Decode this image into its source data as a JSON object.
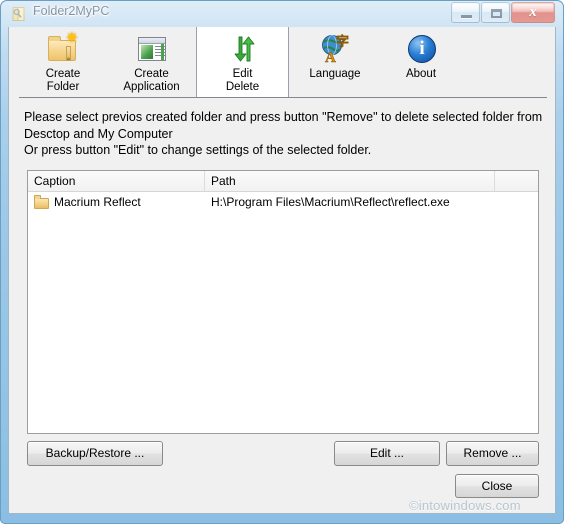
{
  "window": {
    "title": "Folder2MyPC",
    "title_icon": "folder2mypc-app-icon",
    "controls": {
      "minimize_label": "Minimize",
      "maximize_label": "Maximize",
      "close_label": "Close",
      "close_glyph": "x"
    },
    "accent_border_color": "#9ec9e8",
    "close_button_color": "#c8362c"
  },
  "toolbar": {
    "items": [
      {
        "id": "create-folder",
        "label": "Create\nFolder",
        "icon": "folder-new-icon",
        "selected": false
      },
      {
        "id": "create-application",
        "label": "Create\nApplication",
        "icon": "application-window-icon",
        "selected": false
      },
      {
        "id": "edit-delete",
        "label": "Edit\nDelete",
        "icon": "green-swap-arrows-icon",
        "selected": true
      },
      {
        "id": "language",
        "label": "Language",
        "icon": "globe-language-icon",
        "selected": false
      },
      {
        "id": "about",
        "label": "About",
        "icon": "info-circle-icon",
        "selected": false
      }
    ]
  },
  "instructions": {
    "line1": "Please select previos created folder and press button \"Remove\" to delete selected folder from",
    "line2": "Desctop and My Computer",
    "line3": "Or press button \"Edit\" to change settings of the selected folder."
  },
  "list": {
    "columns": [
      {
        "key": "caption",
        "label": "Caption"
      },
      {
        "key": "path",
        "label": "Path"
      },
      {
        "key": "extra",
        "label": ""
      }
    ],
    "rows": [
      {
        "icon": "folder-icon",
        "caption": "Macrium Reflect",
        "path": "H:\\Program Files\\Macrium\\Reflect\\reflect.exe"
      }
    ]
  },
  "buttons": {
    "backup_restore": "Backup/Restore ...",
    "edit": "Edit ...",
    "remove": "Remove ...",
    "close": "Close"
  },
  "watermark": {
    "text": "©intowindows.com"
  }
}
